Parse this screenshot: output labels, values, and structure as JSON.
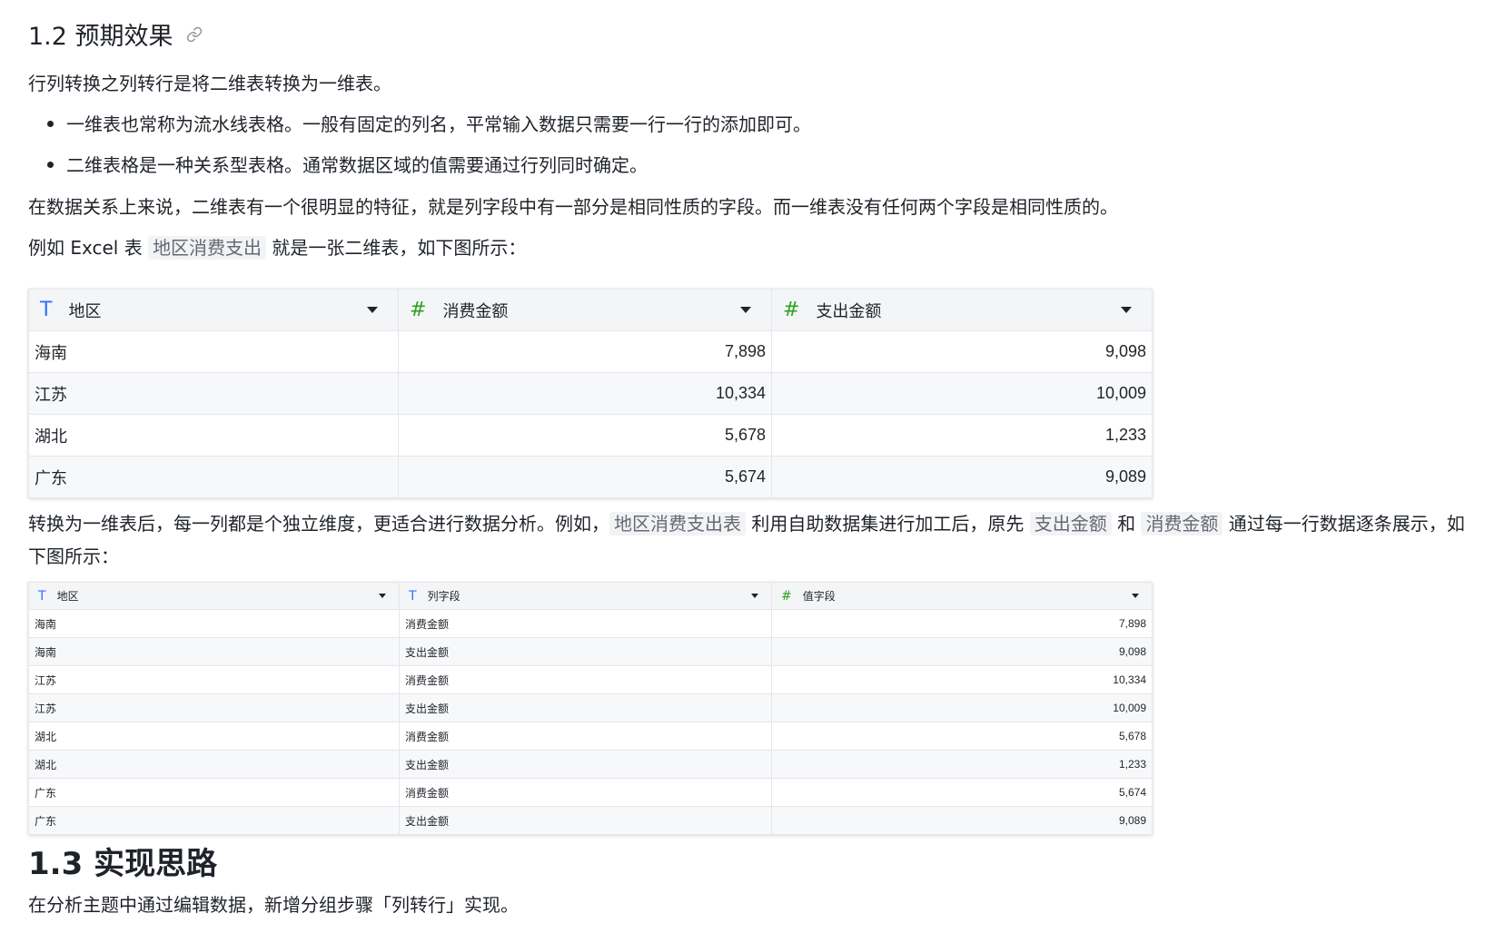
{
  "section_12": {
    "title": "1.2 预期效果",
    "intro": "行列转换之列转行是将二维表转换为一维表。",
    "bullets": [
      "一维表也常称为流水线表格。一般有固定的列名，平常输入数据只需要一行一行的添加即可。",
      "二维表格是一种关系型表格。通常数据区域的值需要通过行列同时确定。"
    ],
    "relation_text": "在数据关系上来说，二维表有一个很明显的特征，就是列字段中有一部分是相同性质的字段。而一维表没有任何两个字段是相同性质的。",
    "example_prefix": "例如 Excel 表 ",
    "example_code": "地区消费支出",
    "example_suffix": " 就是一张二维表，如下图所示：",
    "after_prefix": "转换为一维表后，每一列都是个独立维度，更适合进行数据分析。例如，",
    "after_code1": "地区消费支出表",
    "after_mid1": " 利用自助数据集进行加工后，原先 ",
    "after_code2": "支出金额",
    "after_mid2": " 和 ",
    "after_code3": "消费金额",
    "after_suffix": " 通过每一行数据逐条展示，如下图所示："
  },
  "table_2d": {
    "columns": [
      {
        "type": "T",
        "label": "地区"
      },
      {
        "type": "#",
        "label": "消费金额"
      },
      {
        "type": "#",
        "label": "支出金额"
      }
    ],
    "rows": [
      [
        "海南",
        "7,898",
        "9,098"
      ],
      [
        "江苏",
        "10,334",
        "10,009"
      ],
      [
        "湖北",
        "5,678",
        "1,233"
      ],
      [
        "广东",
        "5,674",
        "9,089"
      ]
    ]
  },
  "table_1d": {
    "columns": [
      {
        "type": "T",
        "label": "地区"
      },
      {
        "type": "T",
        "label": "列字段"
      },
      {
        "type": "#",
        "label": "值字段"
      }
    ],
    "rows": [
      [
        "海南",
        "消费金额",
        "7,898"
      ],
      [
        "海南",
        "支出金额",
        "9,098"
      ],
      [
        "江苏",
        "消费金额",
        "10,334"
      ],
      [
        "江苏",
        "支出金额",
        "10,009"
      ],
      [
        "湖北",
        "消费金额",
        "5,678"
      ],
      [
        "湖北",
        "支出金额",
        "1,233"
      ],
      [
        "广东",
        "消费金额",
        "5,674"
      ],
      [
        "广东",
        "支出金额",
        "9,089"
      ]
    ]
  },
  "section_13": {
    "title": "1.3 实现思路",
    "text": "在分析主题中通过编辑数据，新增分组步骤「列转行」实现。"
  }
}
